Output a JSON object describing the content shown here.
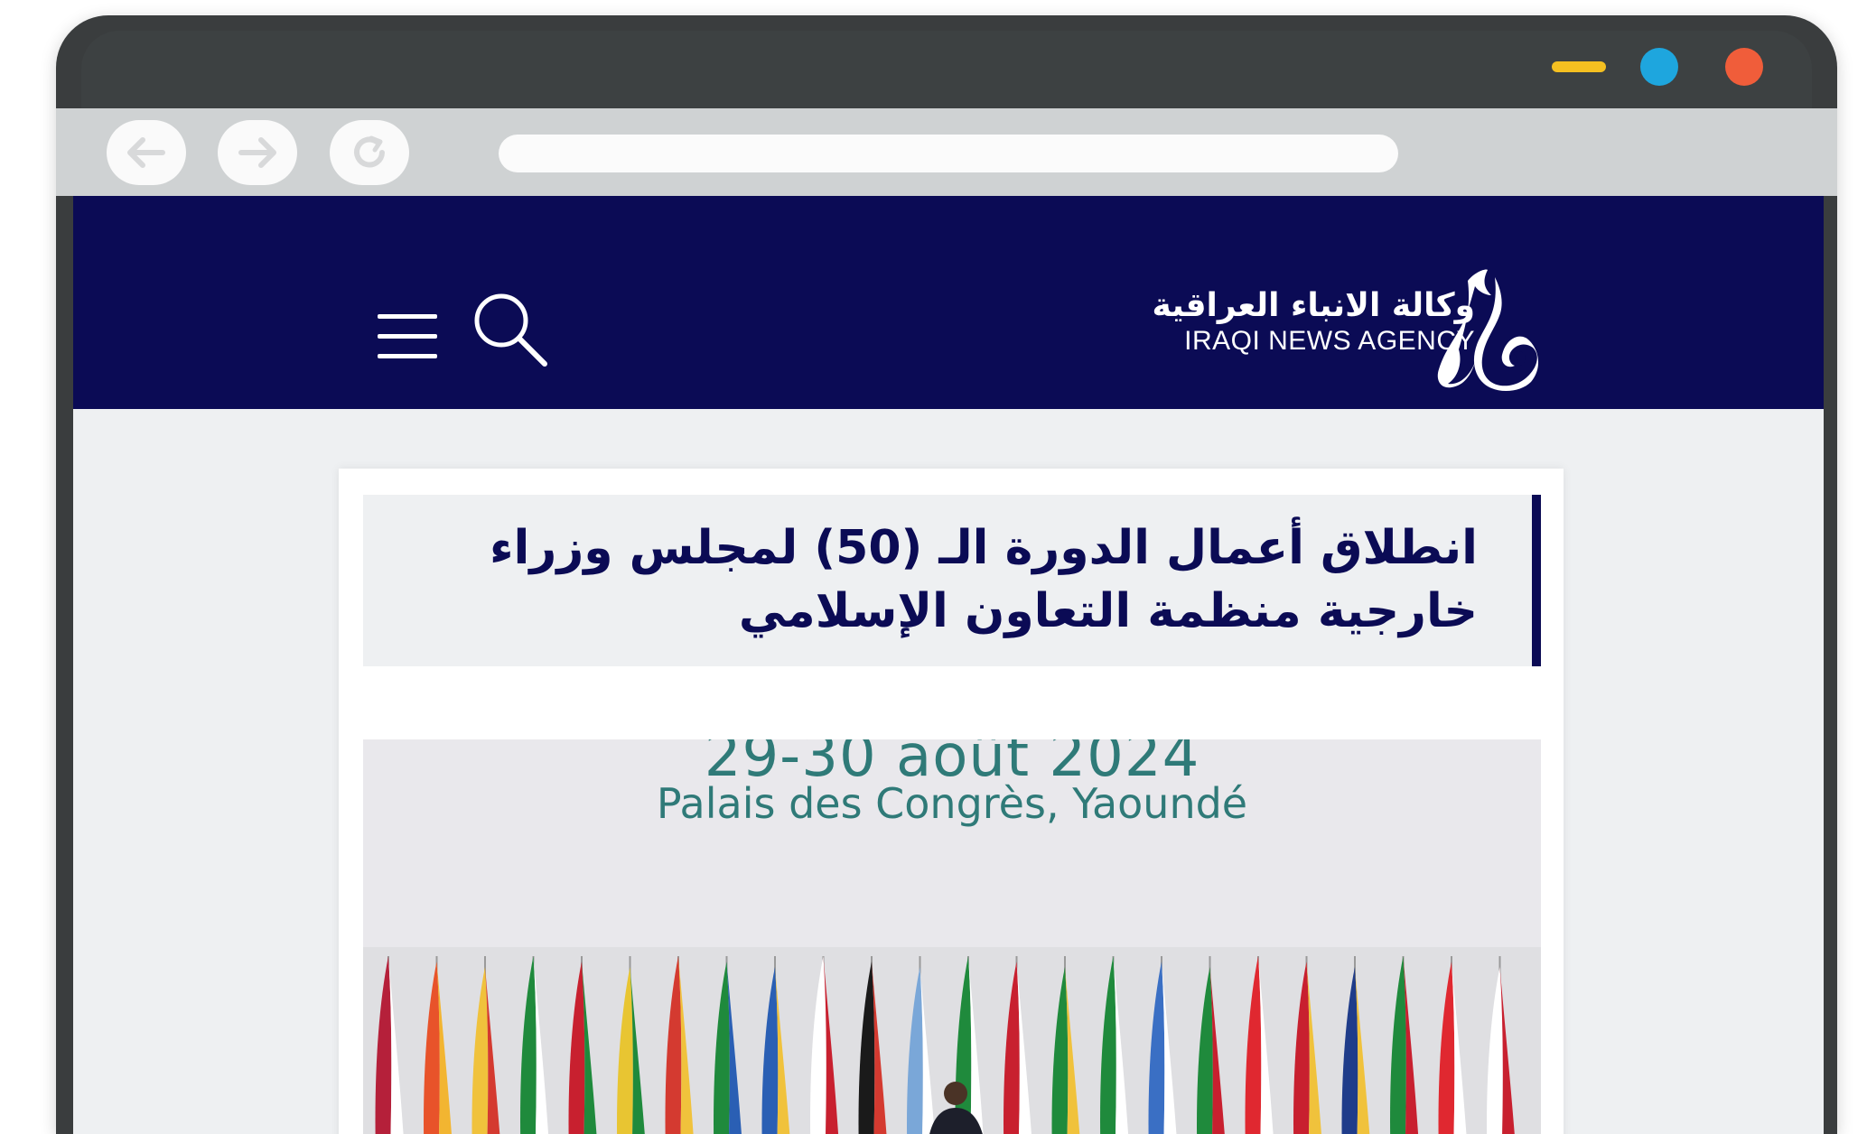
{
  "browser": {
    "window_controls": [
      "minimize",
      "maximize",
      "close"
    ],
    "colors": {
      "minimize": "#f5c021",
      "maximize": "#1ea6de",
      "close": "#f05d3a"
    },
    "nav_icons": [
      "back-arrow-icon",
      "forward-arrow-icon",
      "reload-icon"
    ]
  },
  "site": {
    "logo_ar": "وكالة الانباء العراقية",
    "logo_en": "IRAQI NEWS AGENCY",
    "brand_color": "#0b0b55"
  },
  "article": {
    "headline": "انطلاق أعمال الدورة الـ (50) لمجلس وزراء خارجية منظمة التعاون الإسلامي",
    "image_text_line1": "29-30 août 2024",
    "image_text_line2": "Palais des Congrès, Yaoundé"
  }
}
